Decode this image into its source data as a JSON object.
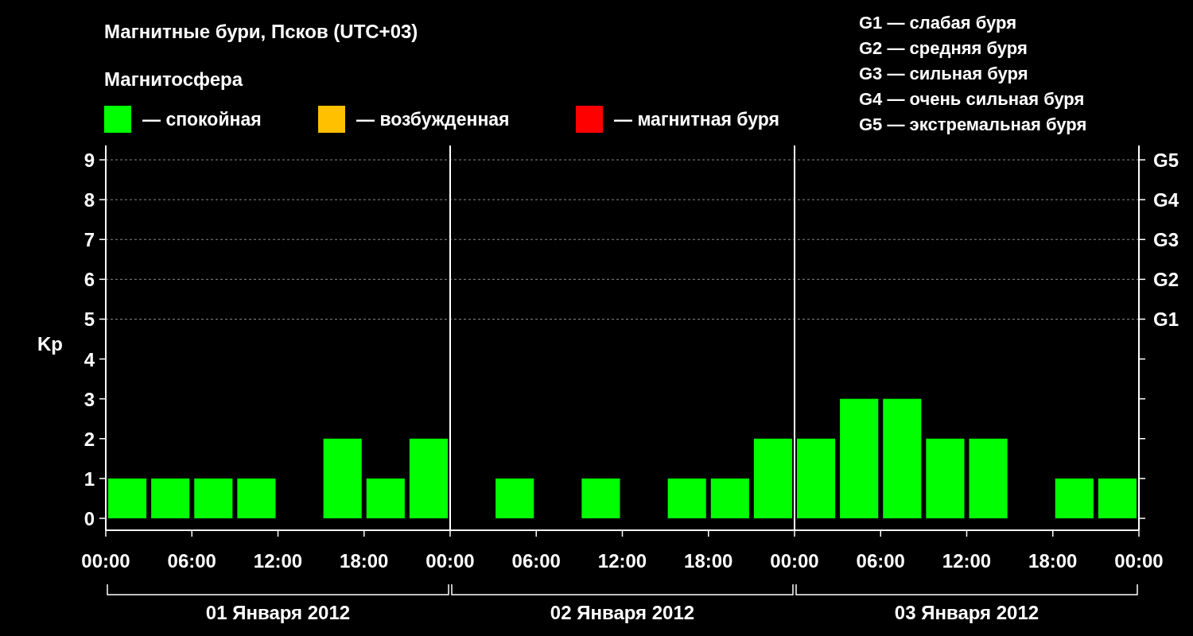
{
  "title": "Магнитные бури, Псков (UTC+03)",
  "legend": {
    "heading": "Магнитосфера",
    "items": [
      {
        "color": "#00ff00",
        "label": "— спокойная"
      },
      {
        "color": "#ffc000",
        "label": "— возбужденная"
      },
      {
        "color": "#ff0000",
        "label": "— магнитная буря"
      }
    ]
  },
  "storm_levels": [
    "G1 — слабая буря",
    "G2 — средняя буря",
    "G3 — сильная буря",
    "G4 — очень сильная буря",
    "G5 — экстремальная буря"
  ],
  "chart": {
    "right_axis_labels": [
      "G5",
      "G4",
      "G3",
      "G2",
      "G1"
    ],
    "time_labels": [
      "00:00",
      "06:00",
      "12:00",
      "18:00",
      "00:00",
      "06:00",
      "12:00",
      "18:00",
      "00:00",
      "06:00",
      "12:00",
      "18:00",
      "00:00"
    ],
    "days": [
      "01 Января 2012",
      "02 Января 2012",
      "03 Января 2012"
    ],
    "chart_data": {
      "type": "bar",
      "ylabel": "Kp",
      "grid": true,
      "categories": [
        null,
        null,
        null,
        null,
        null,
        null,
        null,
        null,
        null,
        null,
        null,
        null,
        null,
        null,
        null,
        null,
        null,
        null,
        null,
        null,
        null,
        null,
        null,
        null
      ],
      "values": [
        1,
        1,
        1,
        1,
        0,
        2,
        1,
        2,
        0,
        1,
        0,
        1,
        0,
        1,
        1,
        2,
        2,
        3,
        3,
        2,
        2,
        0,
        1,
        1
      ],
      "ylim": [
        -0.3,
        9.36
      ],
      "yticks": [
        0,
        1,
        2,
        3,
        4,
        5,
        6,
        7,
        8,
        9
      ]
    }
  }
}
